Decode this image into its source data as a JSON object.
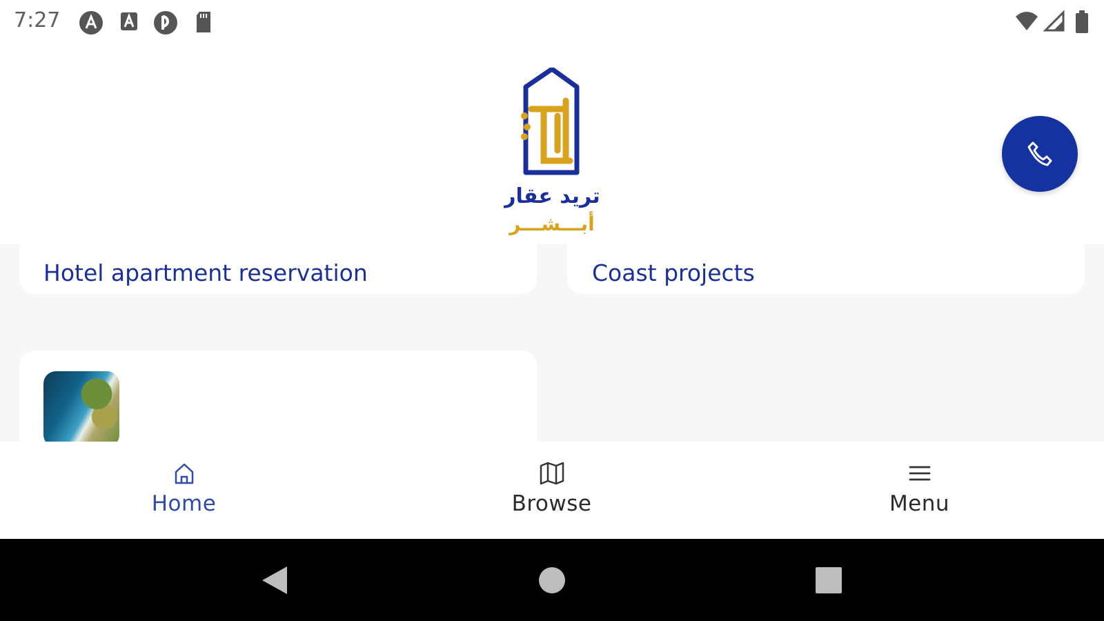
{
  "status_bar": {
    "time": "7:27",
    "left_icons": [
      "app-notification-icon-a",
      "app-notification-icon-b",
      "app-notification-icon-c",
      "sd-card-icon"
    ],
    "right_icons": [
      "wifi-icon",
      "signal-icon",
      "battery-icon"
    ]
  },
  "header": {
    "logo": {
      "arabic_line_1": "تريد عقار",
      "arabic_line_2": "أبـــشـــر",
      "colors": {
        "blue": "#1a2f9c",
        "gold": "#d9a21b"
      }
    },
    "call_button": {
      "icon": "phone-icon",
      "color": "#1533a0"
    }
  },
  "cards": [
    {
      "title": "Hotel apartment reservation"
    },
    {
      "title": "Coast projects"
    },
    {
      "title": "",
      "thumbnail": "coastal-aerial-image"
    }
  ],
  "bottom_nav": {
    "items": [
      {
        "label": "Home",
        "icon": "home-icon",
        "active": true
      },
      {
        "label": "Browse",
        "icon": "map-icon",
        "active": false
      },
      {
        "label": "Menu",
        "icon": "hamburger-icon",
        "active": false
      }
    ],
    "active_color": "#2f4aa8"
  },
  "system_nav": {
    "buttons": [
      "back-icon",
      "home-circle-icon",
      "recents-icon"
    ]
  }
}
